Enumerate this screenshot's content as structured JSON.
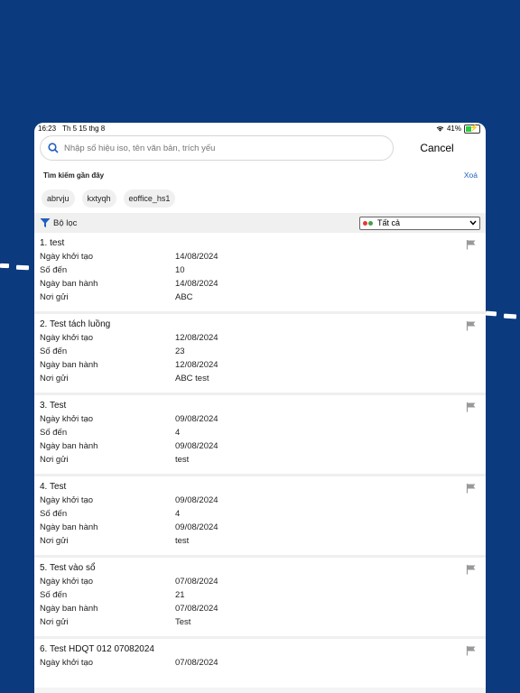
{
  "status": {
    "time": "16:23",
    "date": "Th 5 15 thg 8",
    "battery": "41%"
  },
  "search": {
    "placeholder": "Nhập số hiệu iso, tên văn bản, trích yếu",
    "cancel_label": "Cancel"
  },
  "recent": {
    "title": "Tìm kiếm gần đây",
    "clear_label": "Xoá",
    "chips": [
      "abrvju",
      "kxtyqh",
      "eoffice_hs1"
    ]
  },
  "filter": {
    "label": "Bộ lọc",
    "selected": "Tất cả"
  },
  "labels": {
    "created": "Ngày khởi tạo",
    "number": "Số đến",
    "issued": "Ngày ban hành",
    "sender": "Nơi gửi"
  },
  "items": [
    {
      "title": "1. test",
      "created": "14/08/2024",
      "number": "10",
      "issued": "14/08/2024",
      "sender": "ABC"
    },
    {
      "title": "2. Test tách luồng",
      "created": "12/08/2024",
      "number": "23",
      "issued": "12/08/2024",
      "sender": "ABC test"
    },
    {
      "title": "3. Test",
      "created": "09/08/2024",
      "number": "4",
      "issued": "09/08/2024",
      "sender": "test"
    },
    {
      "title": "4. Test",
      "created": "09/08/2024",
      "number": "4",
      "issued": "09/08/2024",
      "sender": "test"
    },
    {
      "title": "5. Test vào sổ",
      "created": "07/08/2024",
      "number": "21",
      "issued": "07/08/2024",
      "sender": "Test"
    },
    {
      "title": "6. Test HDQT 012 07082024",
      "created": "07/08/2024",
      "number": "",
      "issued": "",
      "sender": ""
    }
  ],
  "colors": {
    "background": "#0b3a7e",
    "accent": "#1f5fbf"
  }
}
